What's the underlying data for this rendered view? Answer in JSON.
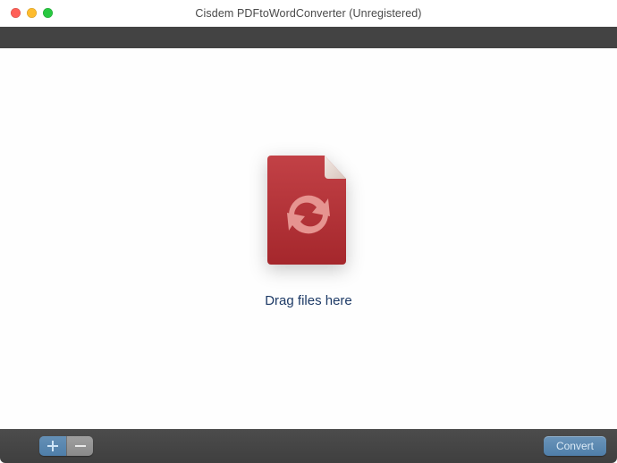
{
  "window": {
    "title": "Cisdem PDFtoWordConverter (Unregistered)"
  },
  "main": {
    "drop_hint": "Drag files here"
  },
  "bottombar": {
    "add_label": "+",
    "remove_label": "−",
    "convert_label": "Convert"
  },
  "colors": {
    "doc_red": "#b82f34",
    "doc_red_dark": "#8f2126",
    "fold": "#e8d7d1",
    "arrows": "#e38c88"
  }
}
